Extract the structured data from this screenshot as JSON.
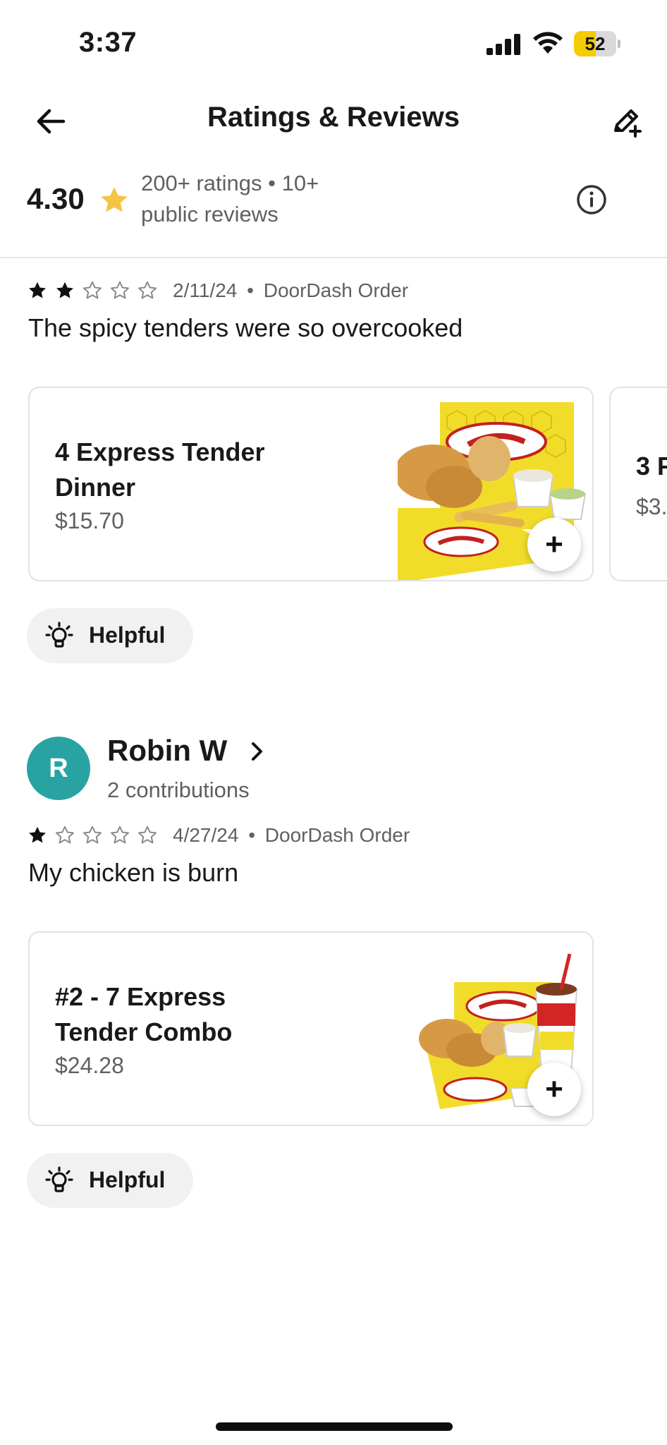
{
  "status_bar": {
    "time": "3:37",
    "battery_level": "52",
    "battery_fraction": 0.52
  },
  "header": {
    "title": "Ratings & Reviews"
  },
  "summary": {
    "rating": "4.30",
    "ratings_count": "200+ ratings",
    "separator": "•",
    "reviews_count": "10+ public reviews"
  },
  "colors": {
    "star": "#f5c445",
    "avatar": "#28a3a2",
    "battery": "#f5cc00"
  },
  "reviews": [
    {
      "stars": 2,
      "date": "2/11/24",
      "separator": "•",
      "source": "DoorDash Order",
      "text": "The spicy tenders were so overcooked",
      "item": {
        "name": "4 Express Tender Dinner",
        "price": "$15.70",
        "add_label": "+"
      },
      "next_item": {
        "name": "3 P",
        "price": "$3."
      },
      "helpful_label": "Helpful"
    },
    {
      "reviewer": {
        "initial": "R",
        "name": "Robin W",
        "contributions": "2 contributions"
      },
      "stars": 1,
      "date": "4/27/24",
      "separator": "•",
      "source": "DoorDash Order",
      "text": "My chicken is burn",
      "item": {
        "name": "#2 - 7 Express Tender Combo",
        "price": "$24.28",
        "add_label": "+"
      },
      "helpful_label": "Helpful"
    }
  ]
}
